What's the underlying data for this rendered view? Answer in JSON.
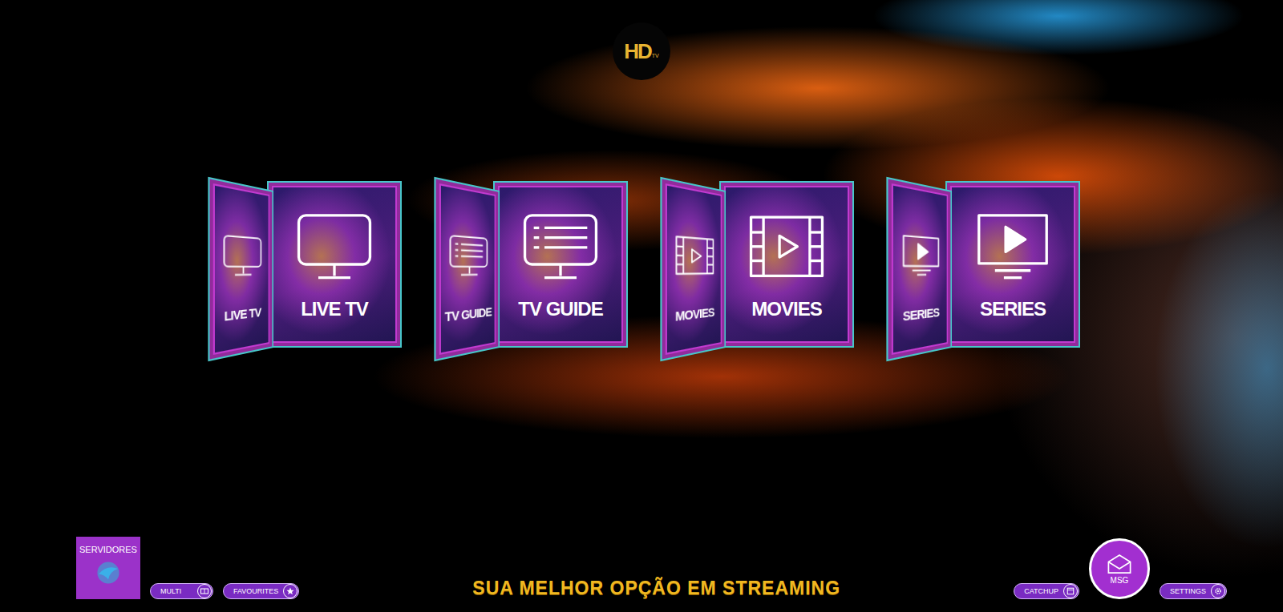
{
  "logo": {
    "text": "HD",
    "badge": "TV"
  },
  "menu": [
    {
      "label": "LIVE TV",
      "kind": "live"
    },
    {
      "label": "TV GUIDE",
      "kind": "guide"
    },
    {
      "label": "MOVIES",
      "kind": "movies"
    },
    {
      "label": "SERIES",
      "kind": "series"
    }
  ],
  "servers": {
    "label": "SERVIDORES"
  },
  "left_buttons": [
    "MULTI",
    "FAVOURITES"
  ],
  "tagline": "SUA MELHOR OPÇÃO EM STREAMING",
  "message": {
    "label": "MSG"
  },
  "right_buttons": [
    "CATCHUP",
    "SETTINGS"
  ]
}
